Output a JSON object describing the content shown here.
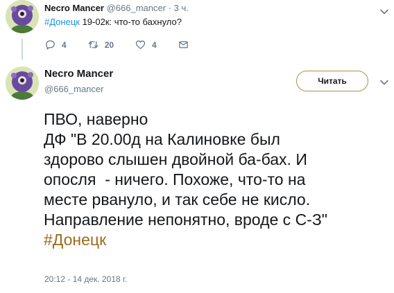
{
  "parent_tweet": {
    "author_name": "Necro Mancer",
    "author_handle": "@666_mancer",
    "separator": "·",
    "time": "3 ч.",
    "hashtag": "#Донецк",
    "text_rest": " 19-02к: что-то бахнуло?",
    "actions": {
      "reply_count": "4",
      "retweet_count": "20",
      "like_count": "4"
    }
  },
  "main_tweet": {
    "author_name": "Necro Mancer",
    "author_handle": "@666_mancer",
    "follow_label": "Читать",
    "body_lines": [
      "ПВО, наверно",
      "ДФ \"В 20.00д на Калиновке был",
      "здорово слышен двойной ба-бах. И",
      "опосля  - ничего. Похоже, что-то на",
      "месте рвануло, и так себе не кисло.",
      "Направление непонятно, вроде с С-З\""
    ],
    "hashtag": "#Донецк",
    "timestamp": "20:12 - 14 дек. 2018 г."
  },
  "colors": {
    "link": "#1b95e0",
    "secondary_text": "#657786",
    "follow_border": "#b68b48",
    "hashtag_main": "#9b6a1c"
  },
  "icons": {
    "reply": "reply-icon",
    "retweet": "retweet-icon",
    "like": "heart-icon",
    "dm": "envelope-icon",
    "more": "chevron-down-icon"
  }
}
